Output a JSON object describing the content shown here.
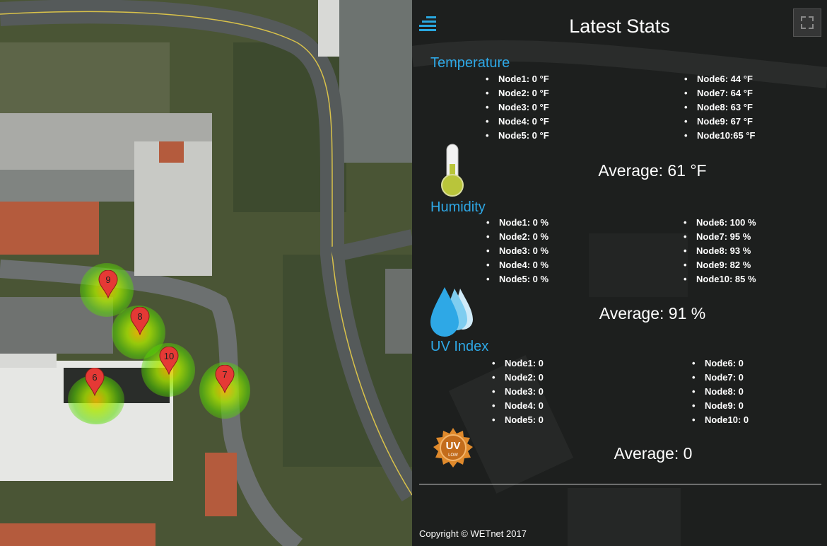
{
  "header": {
    "title": "Latest Stats"
  },
  "temperature": {
    "title": "Temperature",
    "left": [
      "Node1: 0 °F",
      "Node2: 0 °F",
      "Node3: 0 °F",
      "Node4: 0 °F",
      "Node5: 0 °F"
    ],
    "right": [
      "Node6: 44 °F",
      "Node7: 64 °F",
      "Node8: 63 °F",
      "Node9: 67 °F",
      "Node10:65 °F"
    ],
    "average": "Average: 61 °F"
  },
  "humidity": {
    "title": "Humidity",
    "left": [
      "Node1: 0 %",
      "Node2: 0 %",
      "Node3: 0 %",
      "Node4: 0 %",
      "Node5: 0 %"
    ],
    "right": [
      "Node6: 100 %",
      "Node7: 95 %",
      "Node8: 93 %",
      "Node9: 82 %",
      "Node10: 85 %"
    ],
    "average": "Average: 91 %"
  },
  "uv": {
    "title": "UV Index",
    "left": [
      "Node1: 0",
      "Node2: 0",
      "Node3: 0",
      "Node4: 0",
      "Node5: 0"
    ],
    "right": [
      "Node6: 0",
      "Node7: 0",
      "Node8: 0",
      "Node9: 0",
      "Node10: 0"
    ],
    "average": "Average: 0",
    "badge_top": "UV",
    "badge_bottom": "LOW"
  },
  "footer": {
    "copyright": "Copyright © WETnet 2017"
  },
  "map": {
    "markers": [
      "9",
      "8",
      "10",
      "6",
      "7"
    ]
  },
  "colors": {
    "accent": "#2ea8e6",
    "marker": "#e53935",
    "panel_bg": "#1d1f1e"
  },
  "icons": [
    "menu-icon",
    "fullscreen-icon",
    "thermometer-icon",
    "water-drops-icon",
    "uv-badge-icon",
    "map-marker-icon"
  ]
}
